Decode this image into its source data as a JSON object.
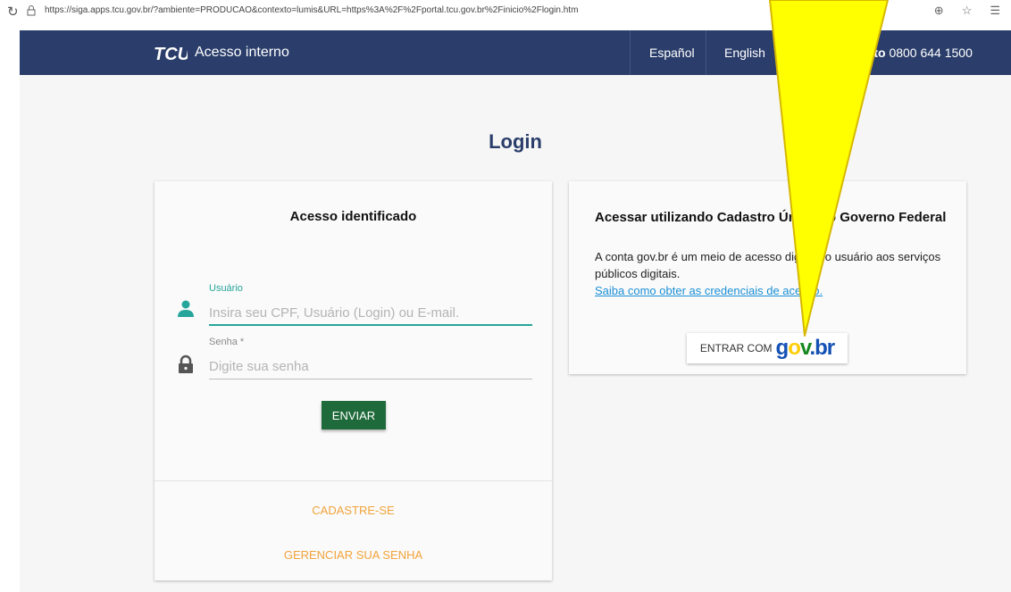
{
  "browser": {
    "url": "https://siga.apps.tcu.gov.br/?ambiente=PRODUCAO&contexto=lumis&URL=https%3A%2F%2Fportal.tcu.gov.br%2Finicio%2Flogin.htm"
  },
  "header": {
    "logo_text": "TCU",
    "title": "Acesso interno",
    "languages": [
      "Español",
      "English"
    ],
    "phone_label": "Atendimento",
    "phone_number": "0800 644 1500",
    "bg_color": "#2b3e6b"
  },
  "page": {
    "title": "Login"
  },
  "identified": {
    "heading": "Acesso identificado",
    "user_label": "Usuário",
    "user_placeholder": "Insira seu CPF, Usuário (Login) ou E-mail.",
    "user_value": "",
    "password_label": "Senha *",
    "password_placeholder": "Digite sua senha",
    "password_value": "",
    "submit_label": "ENVIAR",
    "register_label": "CADASTRE-SE",
    "manage_password_label": "GERENCIAR SUA SENHA",
    "accent_color": "#26a69a",
    "link_color": "#f2a33a"
  },
  "govbr": {
    "heading": "Acessar utilizando Cadastro Único do Governo Federal",
    "description": "A conta gov.br é um meio de acesso digital do usuário aos serviços públicos digitais.",
    "help_link": "Saiba como obter as credenciais de acesso.",
    "button_prefix": "ENTRAR COM",
    "button_logo": "gov.br"
  },
  "icons": {
    "reload": "reload-icon",
    "lock_url": "padlock-icon",
    "phone": "phone-icon",
    "user": "user-icon",
    "password": "lock-icon"
  }
}
